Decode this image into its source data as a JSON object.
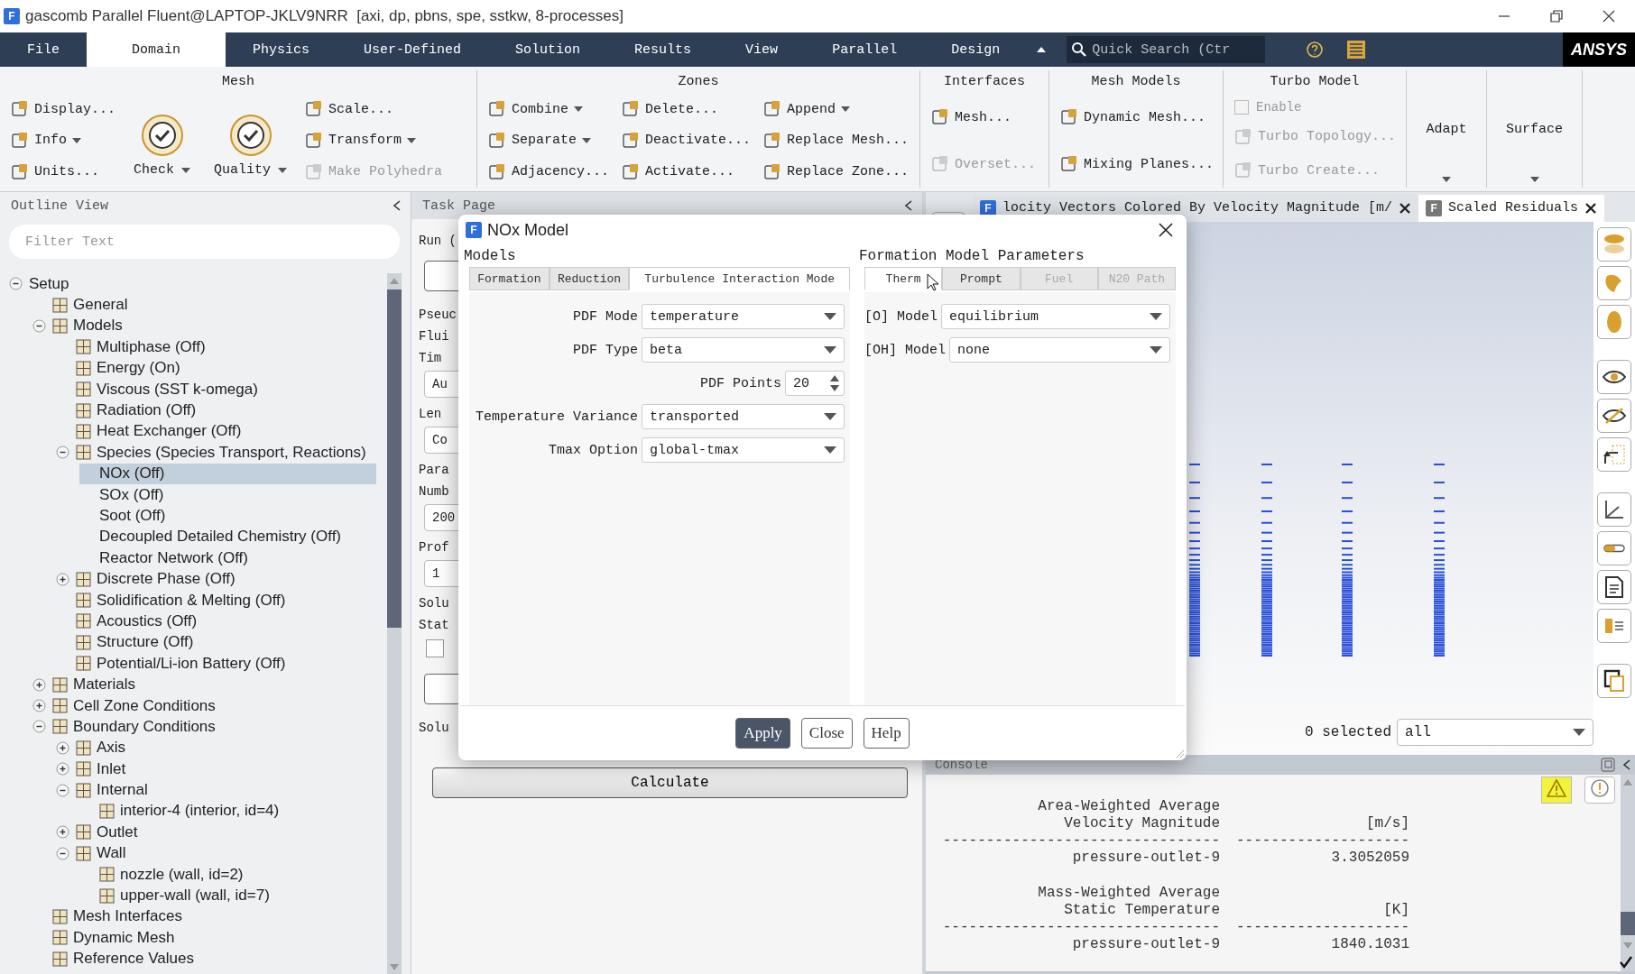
{
  "window": {
    "icon": "F",
    "title": "gascomb Parallel Fluent@LAPTOP-JKLV9NRR  [axi, dp, pbns, spe, sstkw, 8-processes]"
  },
  "menu_tabs": [
    {
      "label": "File",
      "selected": false
    },
    {
      "label": "Domain",
      "selected": true
    },
    {
      "label": "Physics",
      "selected": false
    },
    {
      "label": "User-Defined",
      "selected": false
    },
    {
      "label": "Solution",
      "selected": false
    },
    {
      "label": "Results",
      "selected": false
    },
    {
      "label": "View",
      "selected": false
    },
    {
      "label": "Parallel",
      "selected": false
    },
    {
      "label": "Design",
      "selected": false
    }
  ],
  "quick_search": {
    "placeholder": "Quick Search (Ctr"
  },
  "logo": "ANSYS",
  "ribbon": [
    {
      "title": "Mesh",
      "columns": [
        [
          {
            "label": "Display...",
            "kind": "small",
            "disabled": false
          },
          {
            "label": "Info",
            "kind": "small",
            "disabled": false,
            "menu": true
          },
          {
            "label": "Units...",
            "kind": "small",
            "disabled": false
          }
        ],
        [
          {
            "label": "Check",
            "kind": "large",
            "disabled": false,
            "menu": true
          }
        ],
        [
          {
            "label": "Quality",
            "kind": "large",
            "disabled": false,
            "menu": true
          }
        ],
        [
          {
            "label": "Scale...",
            "kind": "small",
            "disabled": false
          },
          {
            "label": "Transform",
            "kind": "small",
            "disabled": false,
            "menu": true
          },
          {
            "label": "Make Polyhedra",
            "kind": "small",
            "disabled": true
          }
        ]
      ]
    },
    {
      "title": "Zones",
      "columns": [
        [
          {
            "label": "Combine",
            "kind": "small",
            "disabled": false,
            "menu": true
          },
          {
            "label": "Separate",
            "kind": "small",
            "disabled": false,
            "menu": true
          },
          {
            "label": "Adjacency...",
            "kind": "small",
            "disabled": false
          }
        ],
        [
          {
            "label": "Delete...",
            "kind": "small",
            "disabled": false
          },
          {
            "label": "Deactivate...",
            "kind": "small",
            "disabled": false
          },
          {
            "label": "Activate...",
            "kind": "small",
            "disabled": false
          }
        ],
        [
          {
            "label": "Append",
            "kind": "small",
            "disabled": false,
            "menu": true
          },
          {
            "label": "Replace Mesh...",
            "kind": "small",
            "disabled": false
          },
          {
            "label": "Replace Zone...",
            "kind": "small",
            "disabled": false
          }
        ]
      ]
    },
    {
      "title": "Interfaces",
      "columns": [
        [
          {
            "label": "Mesh...",
            "kind": "small",
            "disabled": false
          },
          {
            "label": "Overset...",
            "kind": "small",
            "disabled": true
          }
        ]
      ]
    },
    {
      "title": "Mesh Models",
      "columns": [
        [
          {
            "label": "Dynamic Mesh...",
            "kind": "small",
            "disabled": false
          },
          {
            "label": "Mixing Planes...",
            "kind": "small",
            "disabled": false
          }
        ]
      ]
    },
    {
      "title": "Turbo Model",
      "columns": [
        [
          {
            "label": "Enable",
            "kind": "check",
            "disabled": true,
            "checked": false
          },
          {
            "label": "Turbo Topology...",
            "kind": "small",
            "disabled": true
          },
          {
            "label": "Turbo Create...",
            "kind": "small",
            "disabled": true
          }
        ]
      ]
    },
    {
      "columns": [
        [
          {
            "label": "Adapt",
            "kind": "text",
            "disabled": false,
            "menu": true
          }
        ]
      ]
    },
    {
      "columns": [
        [
          {
            "label": "Surface",
            "kind": "text",
            "disabled": false,
            "menu": true
          }
        ]
      ]
    }
  ],
  "outline": {
    "title": "Outline View",
    "filter": {
      "placeholder": "Filter Text"
    },
    "tree": [
      {
        "label": "Setup",
        "kind": "text",
        "expanded": true,
        "selected": false,
        "children": [
          {
            "label": "General",
            "selected": false
          },
          {
            "label": "Models",
            "expanded": true,
            "selected": false,
            "children": [
              {
                "label": "Multiphase (Off)",
                "selected": false
              },
              {
                "label": "Energy (On)",
                "selected": false
              },
              {
                "label": "Viscous (SST k-omega)",
                "selected": false
              },
              {
                "label": "Radiation (Off)",
                "selected": false
              },
              {
                "label": "Heat Exchanger (Off)",
                "selected": false
              },
              {
                "label": "Species (Species Transport, Reactions)",
                "expanded": true,
                "selected": false,
                "children": [
                  {
                    "label": "NOx (Off)",
                    "kind": "text",
                    "selected": true
                  },
                  {
                    "label": "SOx (Off)",
                    "kind": "text",
                    "selected": false
                  },
                  {
                    "label": "Soot (Off)",
                    "kind": "text",
                    "selected": false
                  },
                  {
                    "label": "Decoupled Detailed Chemistry (Off)",
                    "kind": "text",
                    "selected": false
                  },
                  {
                    "label": "Reactor Network (Off)",
                    "kind": "text",
                    "selected": false
                  }
                ]
              },
              {
                "label": "Discrete Phase (Off)",
                "expanded": false,
                "selected": false
              },
              {
                "label": "Solidification & Melting (Off)",
                "selected": false
              },
              {
                "label": "Acoustics (Off)",
                "selected": false
              },
              {
                "label": "Structure (Off)",
                "selected": false
              },
              {
                "label": "Potential/Li-ion Battery (Off)",
                "selected": false
              }
            ]
          },
          {
            "label": "Materials",
            "expanded": false,
            "selected": false
          },
          {
            "label": "Cell Zone Conditions",
            "expanded": false,
            "selected": false
          },
          {
            "label": "Boundary Conditions",
            "expanded": true,
            "selected": false,
            "children": [
              {
                "label": "Axis",
                "expanded": false,
                "selected": false
              },
              {
                "label": "Inlet",
                "expanded": false,
                "selected": false
              },
              {
                "label": "Internal",
                "expanded": true,
                "selected": false,
                "children": [
                  {
                    "label": "interior-4 (interior, id=4)",
                    "selected": false
                  }
                ]
              },
              {
                "label": "Outlet",
                "expanded": false,
                "selected": false
              },
              {
                "label": "Wall",
                "expanded": true,
                "selected": false,
                "children": [
                  {
                    "label": "nozzle (wall, id=2)",
                    "selected": false
                  },
                  {
                    "label": "upper-wall (wall, id=7)",
                    "selected": false
                  }
                ]
              }
            ]
          },
          {
            "label": "Mesh Interfaces",
            "selected": false
          },
          {
            "label": "Dynamic Mesh",
            "selected": false
          },
          {
            "label": "Reference Values",
            "selected": false
          }
        ]
      }
    ]
  },
  "task_page": {
    "title": "Task Page",
    "fragments": [
      {
        "kind": "label",
        "text": "Run ("
      },
      {
        "kind": "button"
      },
      {
        "kind": "label",
        "text": "Pseuc"
      },
      {
        "kind": "label",
        "text": "Flui"
      },
      {
        "kind": "label",
        "text": "Tim"
      },
      {
        "kind": "input",
        "text": "Au"
      },
      {
        "kind": "label",
        "text": "Len"
      },
      {
        "kind": "input",
        "text": "Co"
      },
      {
        "kind": "label",
        "text": "Para"
      },
      {
        "kind": "label",
        "text": "Numb"
      },
      {
        "kind": "input",
        "text": "200"
      },
      {
        "kind": "label",
        "text": "Prof"
      },
      {
        "kind": "input",
        "text": "1"
      },
      {
        "kind": "label",
        "text": "Solu"
      },
      {
        "kind": "label",
        "text": "Stat"
      },
      {
        "kind": "checkbox",
        "checked": false
      },
      {
        "kind": "button"
      },
      {
        "kind": "label",
        "text": "Solu"
      }
    ],
    "calculate": "Calculate"
  },
  "graphics": {
    "tabs": [
      {
        "icon": "F",
        "label": "locity Vectors Colored By Velocity Magnitude [m/",
        "selected": false
      },
      {
        "icon": "F",
        "label": "Scaled Residuals",
        "selected": true
      }
    ],
    "selection_label": "0 selected",
    "selection_filter": "all"
  },
  "console": {
    "title": "Console",
    "blocks": [
      {
        "rows": [
          [
            "Area-Weighted Average"
          ],
          [
            "Velocity Magnitude",
            "[m/s]"
          ],
          [
            "--------------------------------",
            "--------------------"
          ],
          [
            "pressure-outlet-9",
            "3.3052059"
          ]
        ]
      },
      {
        "rows": [
          [
            "Mass-Weighted Average"
          ],
          [
            "Static Temperature",
            "[K]"
          ],
          [
            "--------------------------------",
            "--------------------"
          ],
          [
            "pressure-outlet-9",
            "1840.1031"
          ]
        ]
      }
    ]
  },
  "dialog": {
    "icon": "F",
    "title": "NOx Model",
    "left": {
      "title": "Models",
      "tabs": [
        {
          "label": "Formation",
          "selected": false,
          "disabled": false
        },
        {
          "label": "Reduction",
          "selected": false,
          "disabled": false
        },
        {
          "label": "Turbulence Interaction Mode",
          "selected": true,
          "disabled": false
        }
      ],
      "fields": [
        {
          "label": "PDF Mode",
          "kind": "dropdown",
          "value": "temperature"
        },
        {
          "label": "PDF Type",
          "kind": "dropdown",
          "value": "beta"
        },
        {
          "label": "PDF Points",
          "kind": "spinner",
          "value": "20"
        },
        {
          "label": "Temperature Variance",
          "kind": "dropdown",
          "value": "transported"
        },
        {
          "label": "Tmax Option",
          "kind": "dropdown",
          "value": "global-tmax"
        }
      ]
    },
    "right": {
      "title": "Formation Model Parameters",
      "tabs": [
        {
          "label": "Therm",
          "selected": true,
          "disabled": false
        },
        {
          "label": "Prompt",
          "selected": false,
          "disabled": false
        },
        {
          "label": "Fuel",
          "selected": false,
          "disabled": true
        },
        {
          "label": "N20 Path",
          "selected": false,
          "disabled": true
        }
      ],
      "fields": [
        {
          "label": "[O] Model",
          "kind": "dropdown",
          "value": "equilibrium"
        },
        {
          "label": "[OH] Model",
          "kind": "dropdown",
          "value": "none"
        }
      ]
    },
    "buttons": [
      {
        "label": "Apply",
        "primary": true
      },
      {
        "label": "Close",
        "primary": false
      },
      {
        "label": "Help",
        "primary": false
      }
    ]
  }
}
